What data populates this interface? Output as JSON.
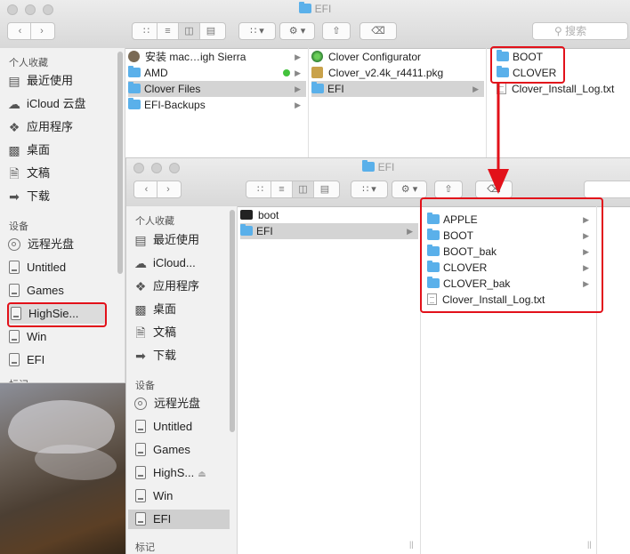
{
  "back_window": {
    "title": "EFI",
    "search_placeholder": "搜索",
    "sidebar": {
      "favorites_header": "个人收藏",
      "favorites": [
        "最近使用",
        "iCloud 云盘",
        "应用程序",
        "桌面",
        "文稿",
        "下载"
      ],
      "devices_header": "设备",
      "devices": [
        "远程光盘",
        "Untitled",
        "Games",
        "HighSie...",
        "Win",
        "EFI"
      ],
      "tags_header_partial": "标记"
    },
    "column1": [
      "安装 mac…igh Sierra",
      "AMD",
      "Clover Files",
      "EFI-Backups"
    ],
    "column2": [
      "Clover Configurator",
      "Clover_v2.4k_r4411.pkg",
      "EFI"
    ],
    "column3": [
      "BOOT",
      "CLOVER",
      "Clover_Install_Log.txt"
    ]
  },
  "front_window": {
    "title": "EFI",
    "sidebar": {
      "favorites_header": "个人收藏",
      "favorites": [
        "最近使用",
        "iCloud...",
        "应用程序",
        "桌面",
        "文稿",
        "下载"
      ],
      "devices_header": "设备",
      "devices": [
        "远程光盘",
        "Untitled",
        "Games",
        "HighS...",
        "Win",
        "EFI"
      ],
      "tags_header_partial": "标记"
    },
    "column1": [
      "boot",
      "EFI"
    ],
    "column2": [
      "APPLE",
      "BOOT",
      "BOOT_bak",
      "CLOVER",
      "CLOVER_bak",
      "Clover_Install_Log.txt"
    ]
  },
  "colors": {
    "annotation_red": "#e2111a",
    "folder_blue": "#5ab0ea",
    "tag_green": "#43c23c"
  }
}
